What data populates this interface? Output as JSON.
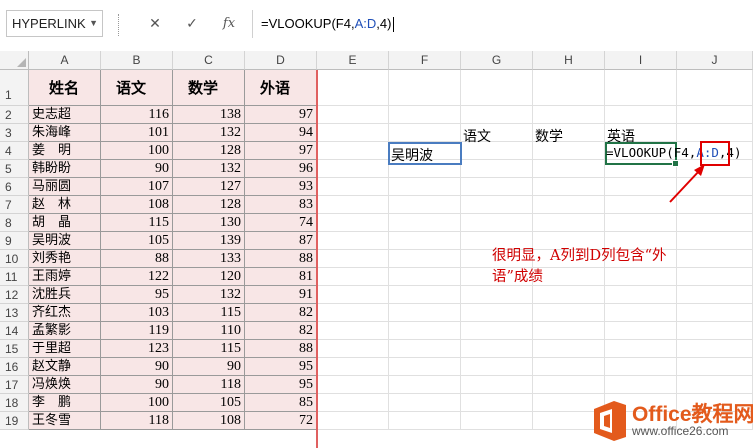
{
  "formula_bar": {
    "name_box": "HYPERLINK",
    "cancel_glyph": "✕",
    "enter_glyph": "✓",
    "fx_glyph": "fx",
    "formula_prefix": "=VLOOKUP(F4,",
    "formula_ref": "A:D",
    "formula_suffix": ",4)"
  },
  "columns": [
    "A",
    "B",
    "C",
    "D",
    "E",
    "F",
    "G",
    "H",
    "I",
    "J"
  ],
  "rows": [
    "1",
    "2",
    "3",
    "4",
    "5",
    "6",
    "7",
    "8",
    "9",
    "10",
    "11",
    "12",
    "13",
    "14",
    "15",
    "16",
    "17",
    "18",
    "19"
  ],
  "table": {
    "headers": [
      "姓名",
      "语文",
      "数学",
      "外语"
    ],
    "data": [
      [
        "史志超",
        "116",
        "138",
        "97"
      ],
      [
        "朱海峰",
        "101",
        "132",
        "94"
      ],
      [
        "姜　明",
        "100",
        "128",
        "97"
      ],
      [
        "韩盼盼",
        "90",
        "132",
        "96"
      ],
      [
        "马丽圆",
        "107",
        "127",
        "93"
      ],
      [
        "赵　林",
        "108",
        "128",
        "83"
      ],
      [
        "胡　晶",
        "115",
        "130",
        "74"
      ],
      [
        "吴明波",
        "105",
        "139",
        "87"
      ],
      [
        "刘秀艳",
        "88",
        "133",
        "88"
      ],
      [
        "王雨婷",
        "122",
        "120",
        "81"
      ],
      [
        "沈胜兵",
        "95",
        "132",
        "91"
      ],
      [
        "齐红杰",
        "103",
        "115",
        "82"
      ],
      [
        "孟繁影",
        "119",
        "110",
        "82"
      ],
      [
        "于里超",
        "123",
        "115",
        "88"
      ],
      [
        "赵文静",
        "90",
        "90",
        "95"
      ],
      [
        "冯焕焕",
        "90",
        "118",
        "95"
      ],
      [
        "李　鹏",
        "100",
        "105",
        "85"
      ],
      [
        "王冬雪",
        "118",
        "108",
        "72"
      ]
    ]
  },
  "lookup": {
    "g3": "语文",
    "h3": "数学",
    "i3": "英语",
    "f4": "吴明波",
    "i4_prefix": "=VLOOKUP(F4,",
    "i4_ref": "A:D",
    "i4_suffix": ",4)"
  },
  "annotation": {
    "line1": "很明显，A列到D列包含“外",
    "line2": "语”成绩",
    "color": "#d00000"
  },
  "watermark": {
    "title": "Office教程网",
    "url": "www.office26.com"
  }
}
